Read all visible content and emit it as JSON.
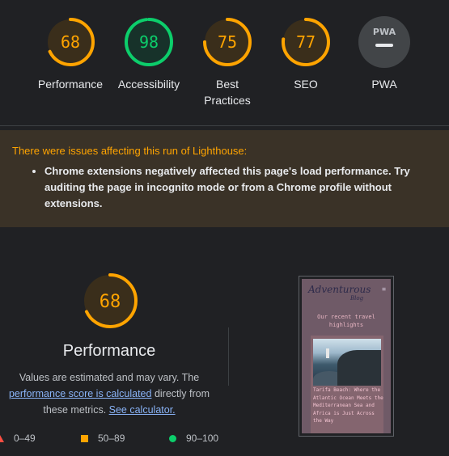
{
  "gauges": [
    {
      "score": "68",
      "value": 68,
      "label": "Performance",
      "color": "#ffa400",
      "bg": "#3a2e1b"
    },
    {
      "score": "98",
      "value": 98,
      "label": "Accessibility",
      "color": "#0cce6b",
      "bg": "#17322a"
    },
    {
      "score": "75",
      "value": 75,
      "label": "Best Practices",
      "color": "#ffa400",
      "bg": "#3a2e1b"
    },
    {
      "score": "77",
      "value": 77,
      "label": "SEO",
      "color": "#ffa400",
      "bg": "#3a2e1b"
    },
    {
      "score": "PWA",
      "label": "PWA",
      "color": "#e8eaed",
      "bg": "#424548"
    }
  ],
  "warning": {
    "title": "There were issues affecting this run of Lighthouse:",
    "items": [
      "Chrome extensions negatively affected this page's load performance. Try auditing the page in incognito mode or from a Chrome profile without extensions."
    ]
  },
  "performance": {
    "score": "68",
    "value": 68,
    "title": "Performance",
    "desc_1": "Values are estimated and may vary. The",
    "link_1": "performance score is calculated",
    "desc_2": " directly from",
    "desc_3": "these metrics. ",
    "link_2": "See calculator."
  },
  "legend": [
    {
      "range": "0–49",
      "shape": "triangle",
      "color": "#ff4e42"
    },
    {
      "range": "50–89",
      "shape": "square",
      "color": "#ffa400"
    },
    {
      "range": "90–100",
      "shape": "circle",
      "color": "#0cce6b"
    }
  ],
  "screenshot": {
    "logo": "Adventurous",
    "logo_sub": "Blog",
    "menu_icon": "hamburger-icon",
    "heading": "Our recent travel highlights",
    "caption": "Tarifa Beach: Where the Atlantic Ocean Meets the Mediterranean Sea and Africa is Just Across the Way"
  }
}
